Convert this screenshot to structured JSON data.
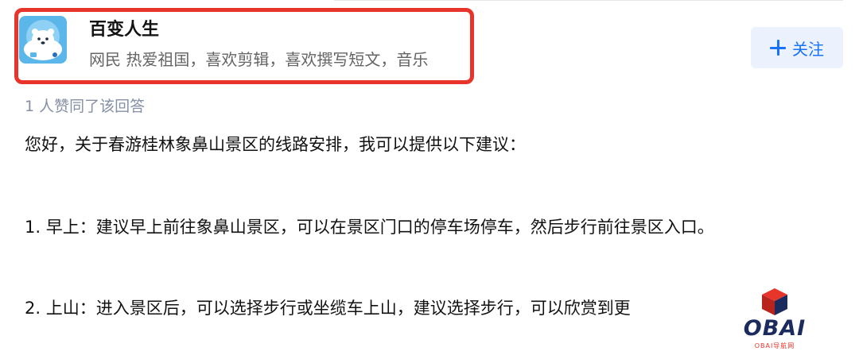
{
  "author": {
    "name": "百变人生",
    "bio": "网民 热爱祖国，喜欢剪辑，喜欢撰写短文，音乐",
    "follow_label": "关注"
  },
  "votes": {
    "text": "1 人赞同了该回答"
  },
  "answer": {
    "paragraphs": [
      "您好，关于春游桂林象鼻山景区的线路安排，我可以提供以下建议：",
      "1. 早上：建议早上前往象鼻山景区，可以在景区门口的停车场停车，然后步行前往景区入口。",
      "2. 上山：进入景区后，可以选择步行或坐缆车上山，建议选择步行，可以欣赏到更"
    ]
  },
  "watermark": {
    "logo_text": "OBAI",
    "tagline": "OBAI导航网"
  },
  "colors": {
    "highlight_border": "#e8352b",
    "accent_blue": "#1772f6",
    "follow_bg": "#ebf2fd",
    "muted_text": "#8590a6"
  },
  "icons": {
    "avatar": "polar-bear-avatar",
    "follow": "plus-icon",
    "watermark": "cube-logo-icon"
  }
}
